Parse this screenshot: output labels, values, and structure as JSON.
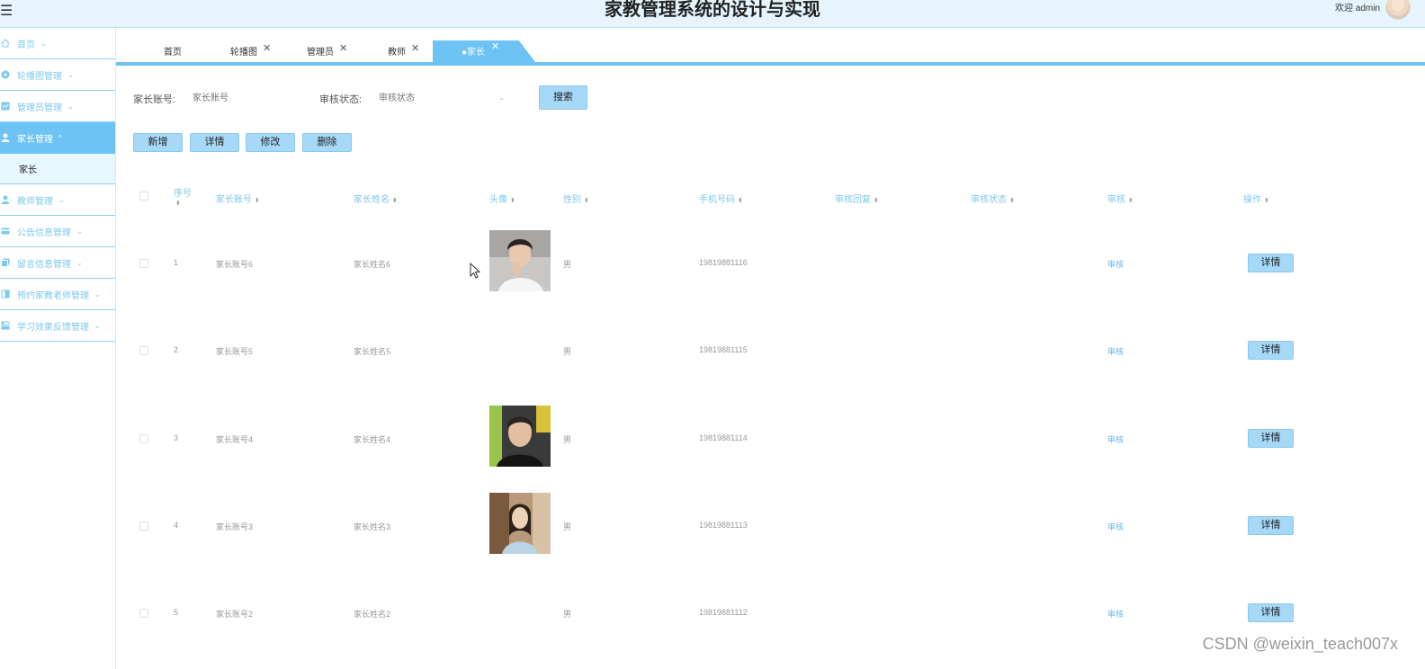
{
  "header": {
    "title": "家教管理系统的设计与实现",
    "welcome": "欢迎 admin"
  },
  "sidebar": {
    "items": [
      {
        "label": "首页",
        "icon": "home-icon"
      },
      {
        "label": "轮播图管理",
        "icon": "carousel-icon"
      },
      {
        "label": "管理员管理",
        "icon": "admin-icon"
      },
      {
        "label": "家长管理",
        "icon": "user-icon",
        "active": true,
        "sub": [
          "家长"
        ]
      },
      {
        "label": "教师管理",
        "icon": "user-icon"
      },
      {
        "label": "公告信息管理",
        "icon": "card-icon"
      },
      {
        "label": "留言信息管理",
        "icon": "message-icon"
      },
      {
        "label": "预约家教老师管理",
        "icon": "book-icon"
      },
      {
        "label": "学习效果反馈管理",
        "icon": "list-icon"
      }
    ]
  },
  "tabs": [
    {
      "label": "首页",
      "closable": false
    },
    {
      "label": "轮播图",
      "closable": true
    },
    {
      "label": "管理员",
      "closable": true
    },
    {
      "label": "教师",
      "closable": true
    },
    {
      "label": "●家长",
      "closable": true,
      "active": true
    }
  ],
  "filters": {
    "account_label": "家长账号:",
    "account_placeholder": "家长账号",
    "status_label": "审核状态:",
    "status_placeholder": "审核状态",
    "search_label": "搜索"
  },
  "actions": {
    "add": "新增",
    "detail": "详情",
    "edit": "修改",
    "delete": "删除"
  },
  "table": {
    "headers": [
      "序号",
      "家长账号",
      "家长姓名",
      "头像",
      "性别",
      "手机号码",
      "审核回复",
      "审核状态",
      "审核",
      "操作"
    ],
    "rows": [
      {
        "index": "1",
        "account": "家长账号6",
        "name": "家长姓名6",
        "has_avatar": true,
        "avatar_style": "man-white-shirt",
        "gender": "男",
        "phone": "19819881116",
        "review": "审核",
        "op": "详情"
      },
      {
        "index": "2",
        "account": "家长账号5",
        "name": "家长姓名5",
        "has_avatar": false,
        "gender": "男",
        "phone": "19819881115",
        "review": "审核",
        "op": "详情"
      },
      {
        "index": "3",
        "account": "家长账号4",
        "name": "家长姓名4",
        "has_avatar": true,
        "avatar_style": "man-black-shirt",
        "gender": "男",
        "phone": "19819881114",
        "review": "审核",
        "op": "详情"
      },
      {
        "index": "4",
        "account": "家长账号3",
        "name": "家长姓名3",
        "has_avatar": true,
        "avatar_style": "woman-street",
        "gender": "男",
        "phone": "19819881113",
        "review": "审核",
        "op": "详情"
      },
      {
        "index": "5",
        "account": "家长账号2",
        "name": "家长姓名2",
        "has_avatar": false,
        "gender": "男",
        "phone": "19819881112",
        "review": "审核",
        "op": "详情"
      }
    ]
  },
  "watermark": "CSDN @weixin_teach007x",
  "colors": {
    "accent": "#6cc3f4",
    "button": "#a6d8f7",
    "header_bg": "#e6f5fd",
    "link": "#6cb9e8"
  }
}
